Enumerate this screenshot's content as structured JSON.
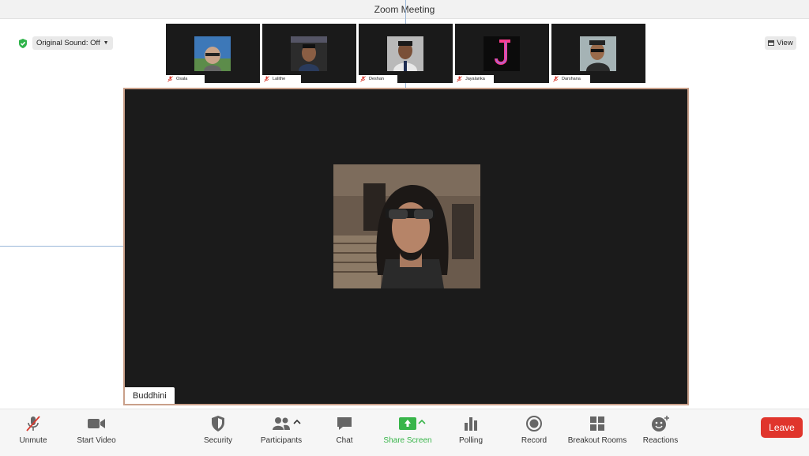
{
  "window": {
    "title": "Zoom Meeting"
  },
  "top_left": {
    "original_sound_label": "Original Sound: Off"
  },
  "top_right": {
    "view_label": "View"
  },
  "participants": [
    {
      "name": "Osala",
      "bg": "#3d78b8"
    },
    {
      "name": "Lalithe",
      "bg": "#2c2c2c"
    },
    {
      "name": "Deshan",
      "bg": "#b9b9b9"
    },
    {
      "name": "Jayalanka",
      "bg": "#0b0b0b"
    },
    {
      "name": "Darshana",
      "bg": "#a5b3b5"
    }
  ],
  "active_speaker": {
    "name": "Buddhini"
  },
  "toolbar": {
    "unmute": "Unmute",
    "start_video": "Start Video",
    "security": "Security",
    "participants": "Participants",
    "chat": "Chat",
    "share_screen": "Share Screen",
    "polling": "Polling",
    "record": "Record",
    "breakout_rooms": "Breakout Rooms",
    "reactions": "Reactions",
    "leave": "Leave"
  },
  "colors": {
    "accent_green": "#38b54a",
    "leave_red": "#e0352c",
    "active_border": "#c9a08a",
    "muted_red": "#d93a2f"
  }
}
